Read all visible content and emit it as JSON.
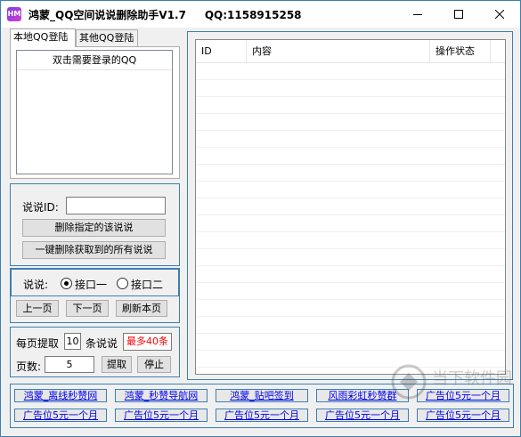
{
  "window": {
    "icon_text": "HM",
    "title": "鸿蒙_QQ空间说说删除助手V1.7     QQ:1158915258"
  },
  "tabs": {
    "local": "本地QQ登陆",
    "other": "其他QQ登陆"
  },
  "qq_list": {
    "header": "双击需要登录的QQ"
  },
  "delete_panel": {
    "id_label": "说说ID:",
    "id_value": "",
    "delete_one": "删除指定的该说说",
    "delete_all": "一键删除获取到的所有说说"
  },
  "interface": {
    "label": "说说:",
    "option1": "接口一",
    "option2": "接口二",
    "selected": "option1"
  },
  "paging": {
    "prev": "上一页",
    "next": "下一页",
    "refresh": "刷新本页"
  },
  "fetch": {
    "per_page_label": "每页提取",
    "per_page_value": "10",
    "unit_label": "条说说",
    "max_badge": "最多40条",
    "pages_label": "页数:",
    "pages_value": "5",
    "fetch_button": "提取",
    "stop_button": "停止"
  },
  "table": {
    "columns": [
      "ID",
      "内容",
      "操作状态"
    ],
    "rows": []
  },
  "links": {
    "row1": [
      "鸿蒙_离线秒赞网",
      "鸿蒙_秒赞导航网",
      "鸿蒙_贴吧签到",
      "风雨彩虹秒赞群",
      "广告位5元一个月"
    ],
    "row2": [
      "广告位5元一个月",
      "广告位5元一个月",
      "广告位5元一个月",
      "广告位5元一个月",
      "广告位5元一个月"
    ]
  },
  "watermark": {
    "text": "当下软件园"
  },
  "colors": {
    "accent_border": "#3c7fb1",
    "link": "#0000ee",
    "warning": "#ff0000"
  }
}
